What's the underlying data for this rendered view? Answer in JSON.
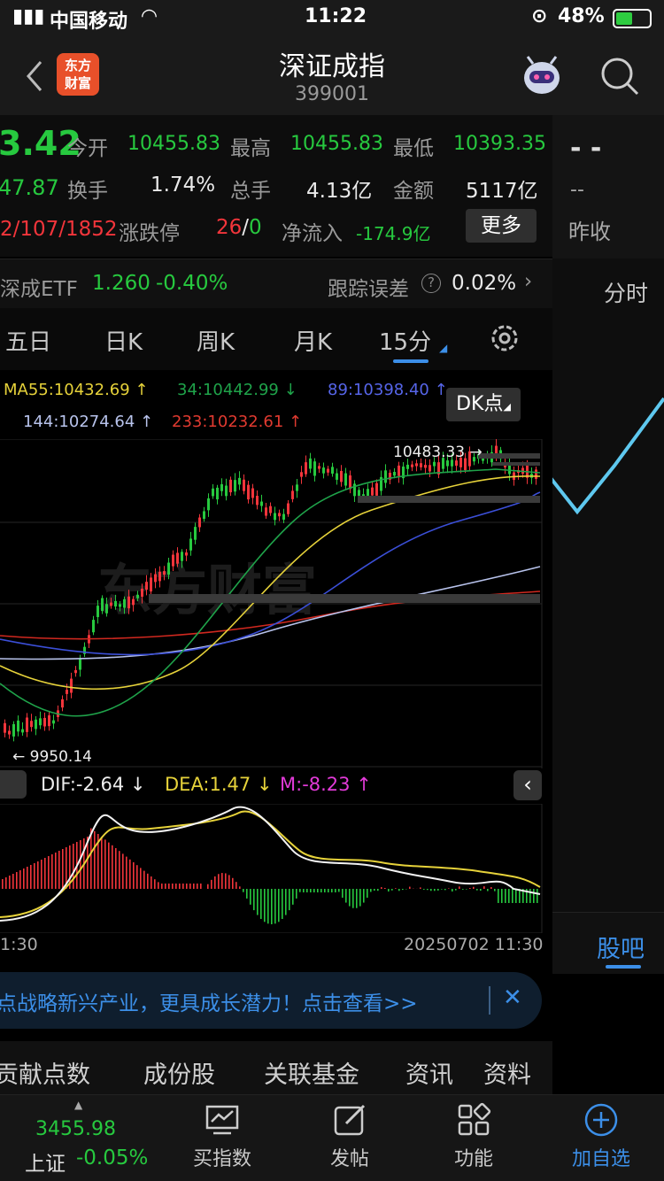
{
  "status_bar": {
    "carrier": "中国移动",
    "time": "11:22",
    "battery": "48%"
  },
  "header": {
    "title": "深证成指",
    "code": "399001",
    "logo_text": "东方\n财富"
  },
  "quote": {
    "price_partial": "3.42",
    "change_partial": "47.87",
    "ratio_partial": "2/107/1852",
    "open_label": "今开",
    "open_value": "10455.83",
    "high_label": "最高",
    "high_value": "10455.83",
    "low_label": "最低",
    "low_value": "10393.35",
    "turnover_label": "换手",
    "turnover_value": "1.74%",
    "volume_label": "总手",
    "volume_value": "4.13亿",
    "amount_label": "金额",
    "amount_value": "5117亿",
    "limit_label": "涨跌停",
    "limit_up": "26",
    "limit_sep": "/",
    "limit_down": "0",
    "netflow_label": "净流入",
    "netflow_value": "-174.9亿",
    "more_button": "更多"
  },
  "right_panel": {
    "dash1": "- -",
    "dash2": "--",
    "prev_close_label": "昨收",
    "intraday_label": "分时",
    "forum_label": "股吧"
  },
  "etf_row": {
    "name": "深成ETF",
    "price": "1.260",
    "change": "-0.40%",
    "track_label": "跟踪误差",
    "track_value": "0.02%"
  },
  "period_tabs": [
    "五日",
    "日K",
    "周K",
    "月K",
    "15分"
  ],
  "ma_legend": {
    "ma55": "MA55:10432.69",
    "ma34": "34:10442.99",
    "ma89": "89:10398.40",
    "ma144": "144:10274.64",
    "ma233": "233:10232.61",
    "dk_button": "DK点"
  },
  "chart_labels": {
    "high_mark": "10483.33",
    "low_mark": "9950.14",
    "watermark": "东方财富"
  },
  "macd": {
    "dif": "DIF:-2.64",
    "dea": "DEA:1.47",
    "m": "M:-8.23"
  },
  "time_axis": {
    "left": "1:30",
    "right": "20250702 11:30"
  },
  "banner": {
    "text": "点战略新兴产业，更具成长潜力！点击查看>>"
  },
  "sub_tabs": [
    "贡献点数",
    "成份股",
    "关联基金",
    "资讯",
    "资料"
  ],
  "bottom_nav": {
    "index_value": "3455.98",
    "index_name": "上证",
    "index_change": "-0.05%",
    "items": [
      "买指数",
      "发帖",
      "功能",
      "加自选"
    ]
  },
  "colors": {
    "up": "#f2353b",
    "down": "#27c93f",
    "accent": "#3c8fe8",
    "ma55": "#e6d23a",
    "ma34": "#1fa34a",
    "ma89": "#3b4fd8",
    "ma144": "#b8c3ec",
    "ma233": "#d0281f"
  }
}
